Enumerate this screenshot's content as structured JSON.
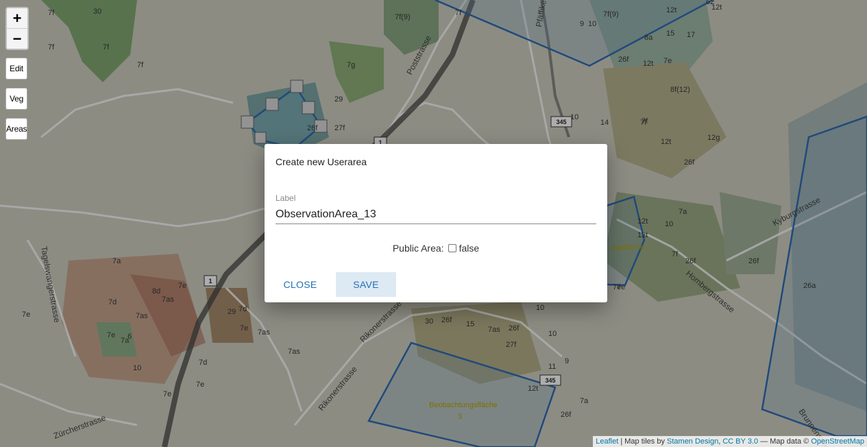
{
  "map": {
    "streets": [
      "Poststrasse",
      "Pfäffikerstrasse",
      "Tagelswangerstrasse",
      "Kyburgstrasse",
      "Hombergstrasse",
      "Rikonerstrasse",
      "Rikonerstrasse",
      "Zürcherstrasse",
      "Brunnenstrasse"
    ],
    "route_shields": [
      "345",
      "345",
      "1",
      "1"
    ],
    "veg_labels": [
      "7f",
      "30",
      "7f",
      "7f",
      "7f",
      "7g",
      "7f(9)",
      "7f",
      "7f(9)",
      "12t",
      "62",
      "12t",
      "10",
      "8a",
      "15",
      "17",
      "7e",
      "12t",
      "8f(12)",
      "12g",
      "7f",
      "12t",
      "26f",
      "29",
      "26f",
      "27f",
      "9",
      "26f",
      "10",
      "14",
      "7a",
      "12t",
      "10",
      "26f",
      "7e",
      "7a",
      "7d",
      "8d",
      "7as",
      "7e",
      "7as",
      "7e",
      "7e",
      "7a",
      "6",
      "10",
      "29",
      "7d",
      "7e",
      "7as",
      "7as",
      "7d",
      "7e",
      "7e",
      "30",
      "26f",
      "15",
      "7as",
      "26f",
      "27f",
      "10",
      "10",
      "9",
      "11",
      "12t",
      "26f",
      "7a",
      "7e",
      "7f",
      "26a",
      "12t",
      "7f",
      "26f"
    ],
    "area_label_line1": "Beobachtungsfläche",
    "area_label_line2": "3",
    "partial_area_label": "...ngsfläche"
  },
  "controls": {
    "zoom_in": "+",
    "zoom_out": "−",
    "edit": "Edit",
    "veg": "Veg",
    "areas": "Areas"
  },
  "attribution": {
    "leaflet": "Leaflet",
    "sep1": " | Map tiles by ",
    "stamen": "Stamen Design",
    "sep2": ", ",
    "cc": "CC BY 3.0",
    "sep3": " — Map data © ",
    "osm": "OpenStreetMap"
  },
  "dialog": {
    "title": "Create new Userarea",
    "label_caption": "Label",
    "label_value": "ObservationArea_13",
    "public_area_label": "Public Area:",
    "public_area_value": "false",
    "close_button": "CLOSE",
    "save_button": "SAVE"
  },
  "colors": {
    "area_stroke": "#2f6db5",
    "accent": "#1f6fb3"
  }
}
